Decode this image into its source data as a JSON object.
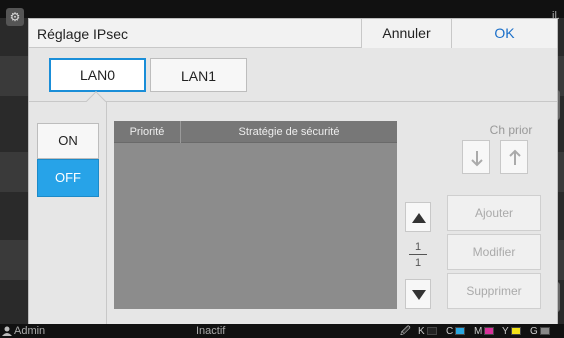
{
  "background": {
    "right_text": "il."
  },
  "dialog": {
    "title": "Réglage IPsec",
    "cancel_label": "Annuler",
    "ok_label": "OK",
    "tabs": [
      {
        "label": "LAN0",
        "active": true
      },
      {
        "label": "LAN1",
        "active": false
      }
    ],
    "toggle": {
      "on_label": "ON",
      "off_label": "OFF",
      "selected": "OFF"
    },
    "table": {
      "columns": [
        "Priorité",
        "Stratégie de sécurité"
      ],
      "rows": []
    },
    "priority_change": {
      "label": "Ch prior",
      "down_icon": "arrow-down-icon",
      "up_icon": "arrow-up-icon"
    },
    "pagination": {
      "current": "1",
      "total": "1"
    },
    "actions": {
      "add_label": "Ajouter",
      "modify_label": "Modifier",
      "delete_label": "Supprimer"
    }
  },
  "status_bar": {
    "user": "Admin",
    "state": "Inactif",
    "inks": [
      {
        "label": "K",
        "color": "#222222"
      },
      {
        "label": "C",
        "color": "#2aa7e0"
      },
      {
        "label": "M",
        "color": "#d8329a"
      },
      {
        "label": "Y",
        "color": "#f2e21a"
      },
      {
        "label": "G",
        "color": "#888888"
      }
    ]
  },
  "colors": {
    "accent": "#1a8ed8",
    "off_selected": "#27a3e8",
    "ok_text": "#1a6fc9"
  }
}
